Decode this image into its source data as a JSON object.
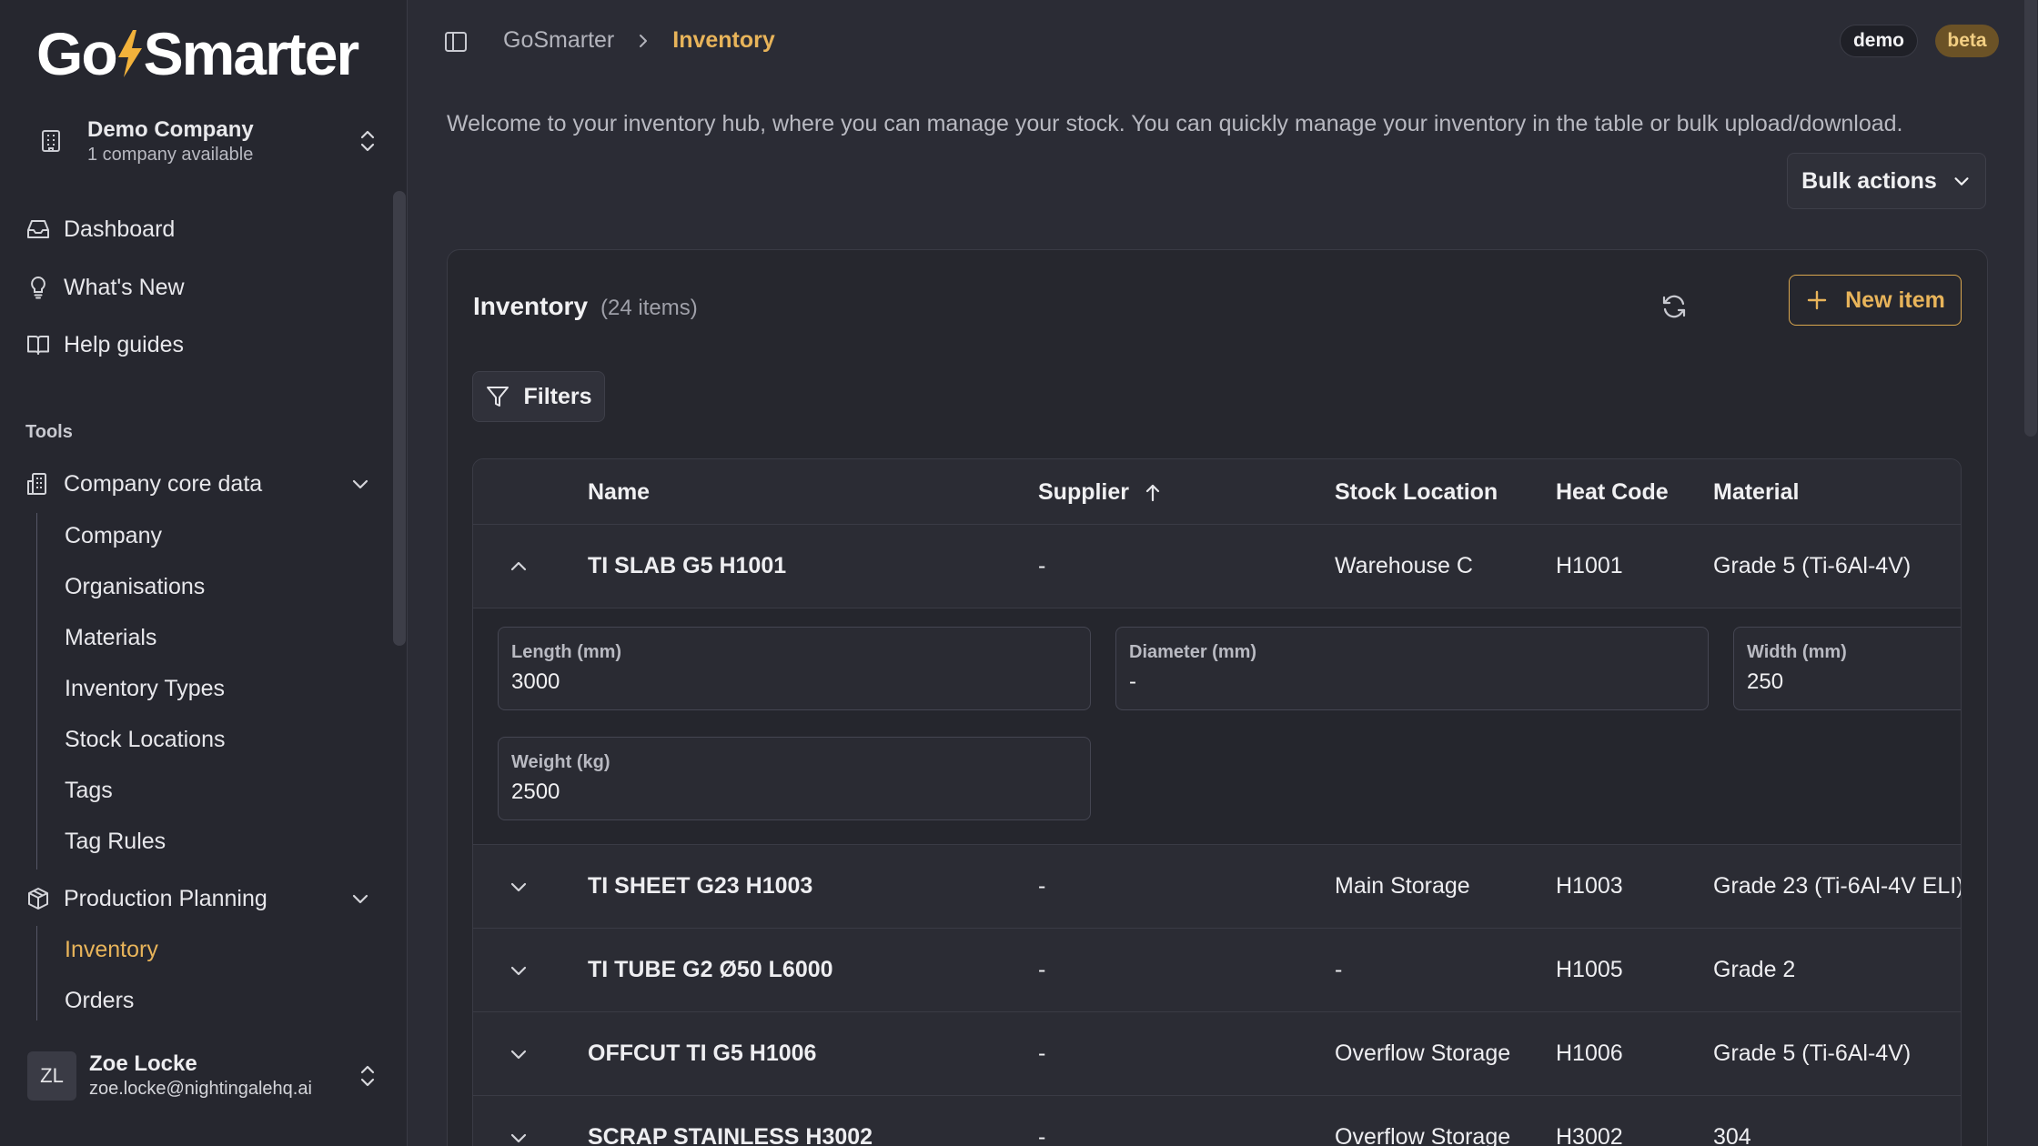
{
  "app": {
    "brand": "GoSmarter"
  },
  "company_switcher": {
    "name": "Demo Company",
    "subtitle": "1 company available"
  },
  "nav": [
    {
      "label": "Dashboard",
      "icon": "inbox-icon"
    },
    {
      "label": "What's New",
      "icon": "lightbulb-icon"
    },
    {
      "label": "Help guides",
      "icon": "book-icon"
    }
  ],
  "tools_label": "Tools",
  "groups": {
    "core": {
      "label": "Company core data",
      "items": [
        "Company",
        "Organisations",
        "Materials",
        "Inventory Types",
        "Stock Locations",
        "Tags",
        "Tag Rules"
      ]
    },
    "planning": {
      "label": "Production Planning",
      "items": [
        "Inventory",
        "Orders"
      ],
      "active": "Inventory"
    }
  },
  "user": {
    "initials": "ZL",
    "name": "Zoe Locke",
    "email": "zoe.locke@nightingalehq.ai"
  },
  "breadcrumb": {
    "root": "GoSmarter",
    "current": "Inventory"
  },
  "badges": {
    "demo": "demo",
    "beta": "beta"
  },
  "welcome": "Welcome to your inventory hub, where you can manage your stock. You can quickly manage your inventory in the table or bulk upload/download.",
  "bulk_actions": "Bulk actions",
  "card": {
    "title": "Inventory",
    "count": "(24 items)",
    "new_item": "New item",
    "filters": "Filters"
  },
  "table": {
    "columns": [
      "Name",
      "Supplier",
      "Stock Location",
      "Heat Code",
      "Material"
    ],
    "sort_column": "Supplier",
    "rows": [
      {
        "name": "TI SLAB G5 H1001",
        "supplier": "-",
        "location": "Warehouse C",
        "heat": "H1001",
        "material": "Grade 5 (Ti-6Al-4V)",
        "expanded": true
      },
      {
        "name": "TI SHEET G23 H1003",
        "supplier": "-",
        "location": "Main Storage",
        "heat": "H1003",
        "material": "Grade 23 (Ti-6Al-4V ELI)"
      },
      {
        "name": "TI TUBE G2 Ø50 L6000",
        "supplier": "-",
        "location": "-",
        "heat": "H1005",
        "material": "Grade 2"
      },
      {
        "name": "OFFCUT TI G5 H1006",
        "supplier": "-",
        "location": "Overflow Storage",
        "heat": "H1006",
        "material": "Grade 5 (Ti-6Al-4V)"
      },
      {
        "name": "SCRAP STAINLESS H3002",
        "supplier": "-",
        "location": "Overflow Storage",
        "heat": "H3002",
        "material": "304"
      }
    ],
    "details": [
      {
        "label": "Length (mm)",
        "value": "3000"
      },
      {
        "label": "Diameter (mm)",
        "value": "-"
      },
      {
        "label": "Width (mm)",
        "value": "250"
      },
      {
        "label": "Weight (kg)",
        "value": "2500"
      }
    ]
  },
  "colors": {
    "accent": "#e8b45a",
    "background": "#2b2c35",
    "sidebar": "#26272f"
  }
}
